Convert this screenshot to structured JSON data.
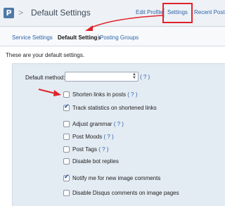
{
  "header": {
    "logo_letter": "P",
    "separator": ">",
    "title": "Default Settings",
    "nav": {
      "edit_profile": "Edit Profile",
      "settings": "Settings",
      "recent_posts": "Recent Posts"
    }
  },
  "subtabs": {
    "service_settings": "Service Settings",
    "default_settings": "Default Settings",
    "posting_groups": "Posting Groups"
  },
  "intro_text": "These are your default settings.",
  "default_method": {
    "label": "Default method:",
    "value": "",
    "help": "( ? )"
  },
  "options": [
    {
      "label": "Shorten links in posts",
      "help": "( ? )",
      "checked": false
    },
    {
      "label": "Track statistics on shortened links",
      "help": "",
      "checked": true
    },
    {
      "label": "Adjust grammar",
      "help": "( ? )",
      "checked": false
    },
    {
      "label": "Post Moods",
      "help": "( ? )",
      "checked": false
    },
    {
      "label": "Post Tags",
      "help": "( ? )",
      "checked": false
    },
    {
      "label": "Disable bot replies",
      "help": "",
      "checked": false
    },
    {
      "label": "Notify me for new image comments",
      "help": "",
      "checked": true
    },
    {
      "label": "Disable Disqus comments on image pages",
      "help": "",
      "checked": false
    }
  ],
  "colors": {
    "link": "#2e63a8",
    "highlight_red": "#e0232b",
    "panel_bg": "#e3ebf3",
    "header_bg": "#eef2f6"
  },
  "icons": {
    "logo": "posterous-logo-icon",
    "select": "updown-arrows-icon",
    "checkmark": "checkmark-icon",
    "annotation": "red-arrow-icon"
  }
}
